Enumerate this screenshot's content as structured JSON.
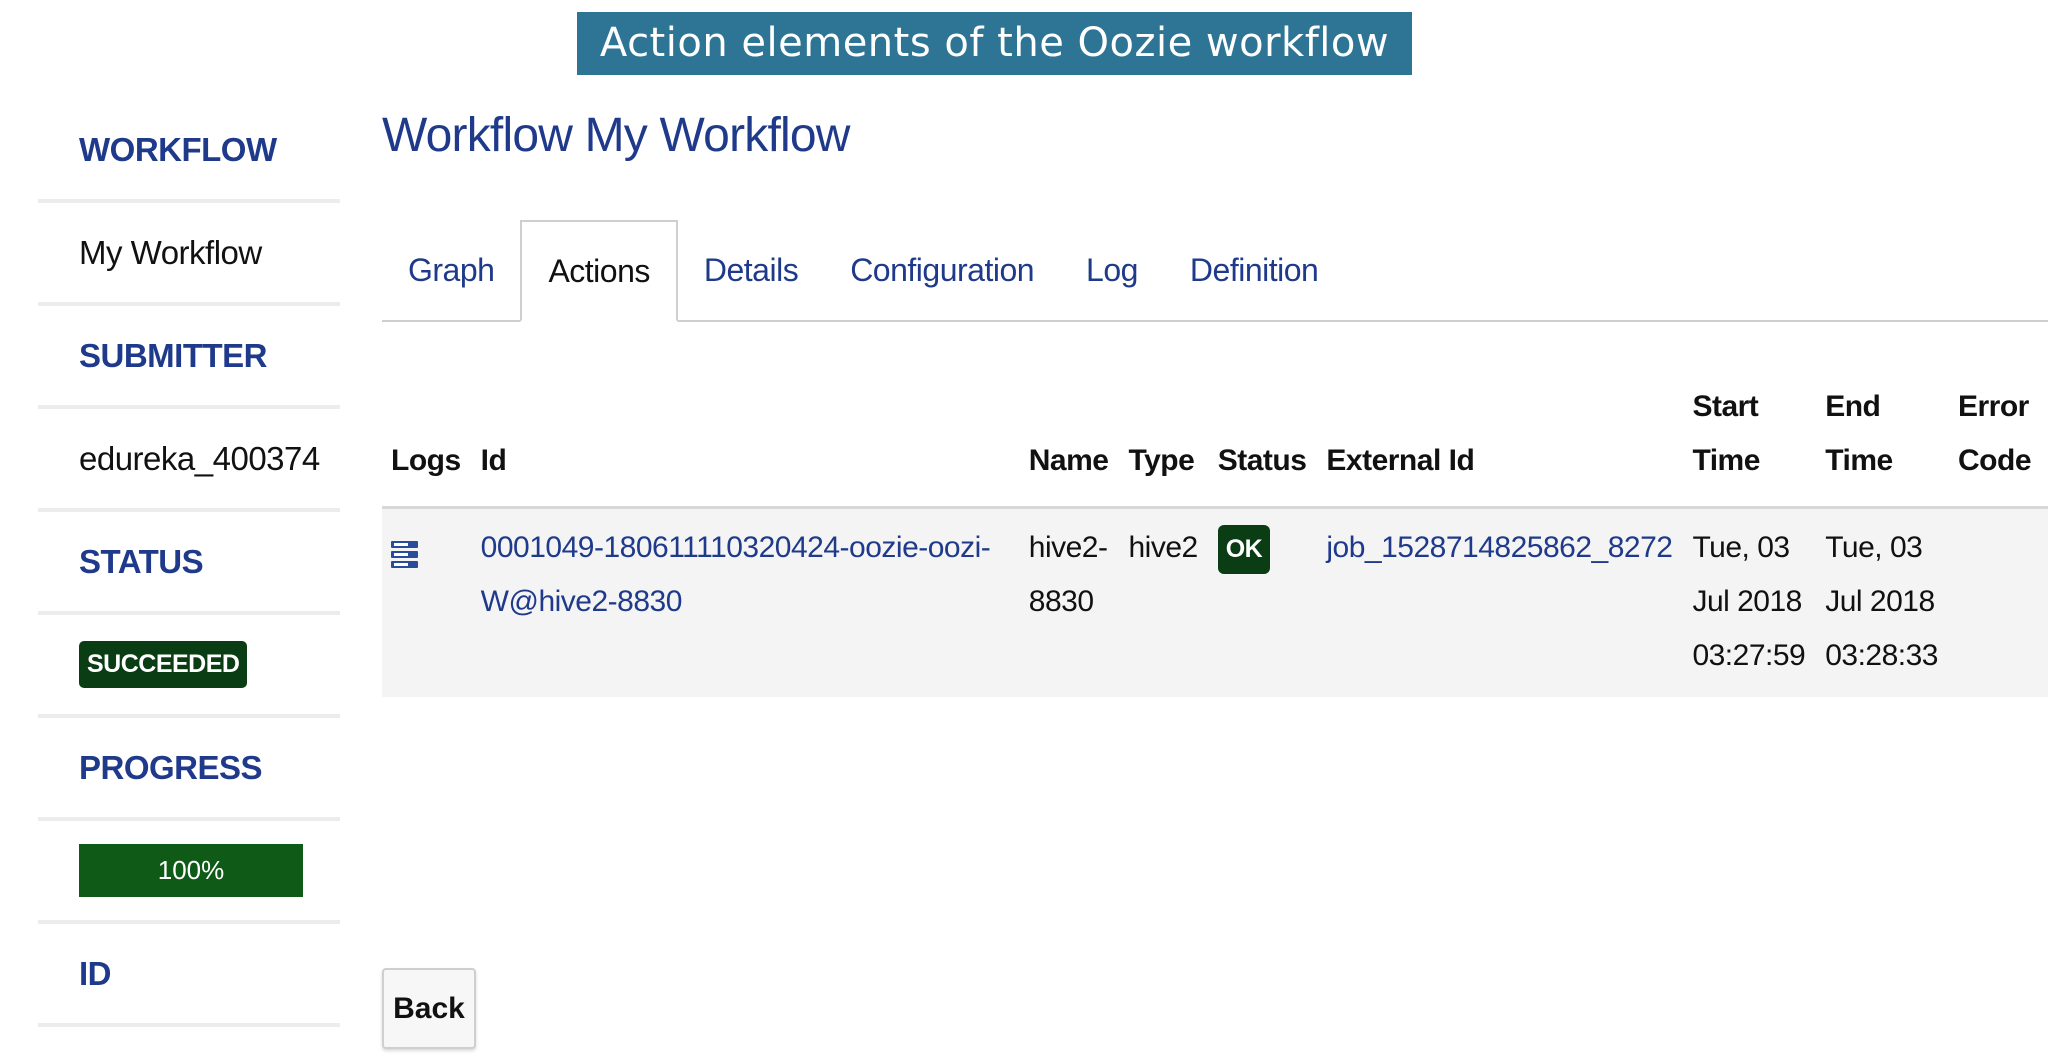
{
  "caption": "Action elements of the Oozie workflow",
  "sidebar": {
    "workflow_label": "WORKFLOW",
    "workflow_value": "My Workflow",
    "submitter_label": "SUBMITTER",
    "submitter_value": "edureka_400374",
    "status_label": "STATUS",
    "status_value": "SUCCEEDED",
    "progress_label": "PROGRESS",
    "progress_value": "100%",
    "progress_fraction": 1.0,
    "id_label": "ID"
  },
  "main": {
    "title": "Workflow My Workflow",
    "tabs": [
      {
        "label": "Graph"
      },
      {
        "label": "Actions"
      },
      {
        "label": "Details"
      },
      {
        "label": "Configuration"
      },
      {
        "label": "Log"
      },
      {
        "label": "Definition"
      }
    ],
    "active_tab": "Actions"
  },
  "table": {
    "headers": {
      "logs": "Logs",
      "id": "Id",
      "name": "Name",
      "type": "Type",
      "status": "Status",
      "external_id": "External Id",
      "start_time_1": "Start",
      "start_time_2": "Time",
      "end_time_1": "End",
      "end_time_2": "Time",
      "error_code_1": "Error",
      "error_code_2": "Code"
    },
    "rows": [
      {
        "id": "0001049-180611110320424-oozie-oozi-W@hive2-8830",
        "name_1": "hive2-",
        "name_2": "8830",
        "type": "hive2",
        "status": "OK",
        "external_id": "job_1528714825862_8272",
        "start_1": "Tue, 03",
        "start_2": "Jul 2018",
        "start_3": "03:27:59",
        "end_1": "Tue, 03",
        "end_2": "Jul 2018",
        "end_3": "03:28:33"
      }
    ]
  },
  "back_label": "Back",
  "colors": {
    "caption_bg": "#2e7495",
    "accent": "#1f3a8a",
    "badge_dark_green": "#0a3d14",
    "progress_green": "#0f5a17"
  },
  "icons": {
    "logs": "log-file-icon"
  }
}
